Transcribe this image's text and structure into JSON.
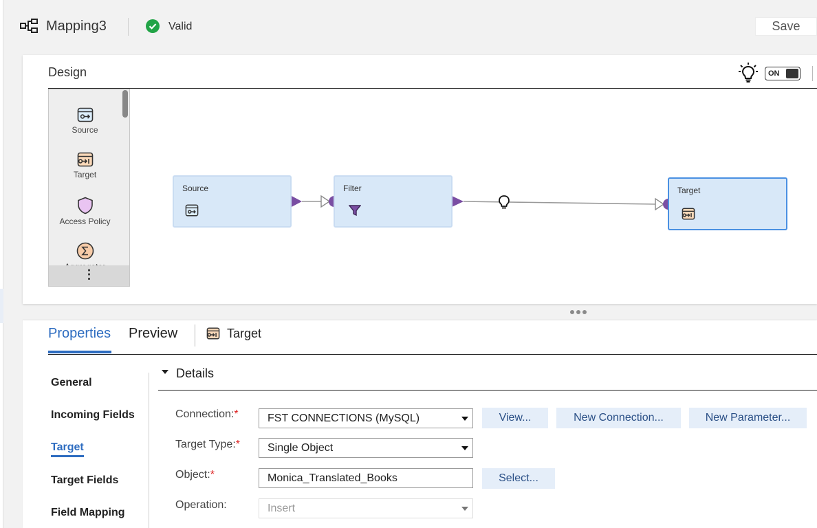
{
  "header": {
    "title": "Mapping3",
    "status": "Valid",
    "save_label": "Save"
  },
  "design": {
    "title": "Design",
    "toggle_label": "ON",
    "palette": [
      {
        "label": "Source",
        "icon": "source-icon"
      },
      {
        "label": "Target",
        "icon": "target-icon"
      },
      {
        "label": "Access Policy",
        "icon": "shield-icon"
      },
      {
        "label": "Aggregator",
        "icon": "sigma-icon"
      }
    ],
    "nodes": {
      "source": "Source",
      "filter": "Filter",
      "target": "Target"
    }
  },
  "properties": {
    "tabs": [
      "Properties",
      "Preview"
    ],
    "object_label": "Target",
    "nav": [
      "General",
      "Incoming Fields",
      "Target",
      "Target Fields",
      "Field Mapping"
    ],
    "section_title": "Details",
    "fields": {
      "connection": {
        "label": "Connection:",
        "value": "FST CONNECTIONS (MySQL)"
      },
      "target_type": {
        "label": "Target Type:",
        "value": "Single Object"
      },
      "object": {
        "label": "Object:",
        "value": "Monica_Translated_Books"
      },
      "operation": {
        "label": "Operation:",
        "value": "Insert"
      }
    },
    "buttons": {
      "view": "View...",
      "new_connection": "New Connection...",
      "new_parameter": "New Parameter...",
      "select": "Select..."
    }
  },
  "colors": {
    "accent": "#2d6cc0",
    "node_fill": "#d8e8f8",
    "port": "#7a4ea3",
    "valid": "#22a447"
  }
}
